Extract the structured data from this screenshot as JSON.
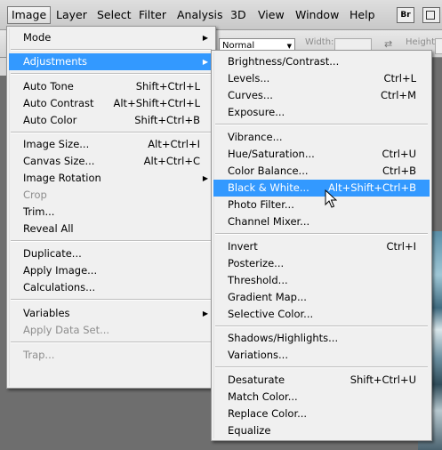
{
  "menubar": {
    "items": [
      {
        "label": "Image",
        "active": true
      },
      {
        "label": "Layer"
      },
      {
        "label": "Select"
      },
      {
        "label": "Filter"
      },
      {
        "label": "Analysis"
      },
      {
        "label": "3D"
      },
      {
        "label": "View"
      },
      {
        "label": "Window"
      },
      {
        "label": "Help"
      }
    ],
    "bridge_button": "Br"
  },
  "options_bar": {
    "style_value": "Normal",
    "width_label": "Width:",
    "height_label": "Height:"
  },
  "image_menu": {
    "items": [
      {
        "label": "Mode",
        "submenu": true
      },
      {
        "label": "Adjustments",
        "submenu": true,
        "highlighted": true
      },
      {
        "label": "Auto Tone",
        "shortcut": "Shift+Ctrl+L"
      },
      {
        "label": "Auto Contrast",
        "shortcut": "Alt+Shift+Ctrl+L"
      },
      {
        "label": "Auto Color",
        "shortcut": "Shift+Ctrl+B"
      },
      {
        "label": "Image Size...",
        "shortcut": "Alt+Ctrl+I"
      },
      {
        "label": "Canvas Size...",
        "shortcut": "Alt+Ctrl+C"
      },
      {
        "label": "Image Rotation",
        "submenu": true
      },
      {
        "label": "Crop",
        "disabled": true
      },
      {
        "label": "Trim..."
      },
      {
        "label": "Reveal All"
      },
      {
        "label": "Duplicate..."
      },
      {
        "label": "Apply Image..."
      },
      {
        "label": "Calculations..."
      },
      {
        "label": "Variables",
        "submenu": true
      },
      {
        "label": "Apply Data Set...",
        "disabled": true
      },
      {
        "label": "Trap...",
        "disabled": true
      }
    ]
  },
  "adjustments_menu": {
    "items": [
      {
        "label": "Brightness/Contrast..."
      },
      {
        "label": "Levels...",
        "shortcut": "Ctrl+L"
      },
      {
        "label": "Curves...",
        "shortcut": "Ctrl+M"
      },
      {
        "label": "Exposure..."
      },
      {
        "label": "Vibrance..."
      },
      {
        "label": "Hue/Saturation...",
        "shortcut": "Ctrl+U"
      },
      {
        "label": "Color Balance...",
        "shortcut": "Ctrl+B"
      },
      {
        "label": "Black & White...",
        "shortcut": "Alt+Shift+Ctrl+B",
        "highlighted": true
      },
      {
        "label": "Photo Filter..."
      },
      {
        "label": "Channel Mixer..."
      },
      {
        "label": "Invert",
        "shortcut": "Ctrl+I"
      },
      {
        "label": "Posterize..."
      },
      {
        "label": "Threshold..."
      },
      {
        "label": "Gradient Map..."
      },
      {
        "label": "Selective Color..."
      },
      {
        "label": "Shadows/Highlights..."
      },
      {
        "label": "Variations..."
      },
      {
        "label": "Desaturate",
        "shortcut": "Shift+Ctrl+U"
      },
      {
        "label": "Match Color..."
      },
      {
        "label": "Replace Color..."
      },
      {
        "label": "Equalize"
      }
    ]
  },
  "colors": {
    "highlight": "#3399ff",
    "menu_bg": "#f0f0f0",
    "disabled_text": "#8d8d8d"
  }
}
